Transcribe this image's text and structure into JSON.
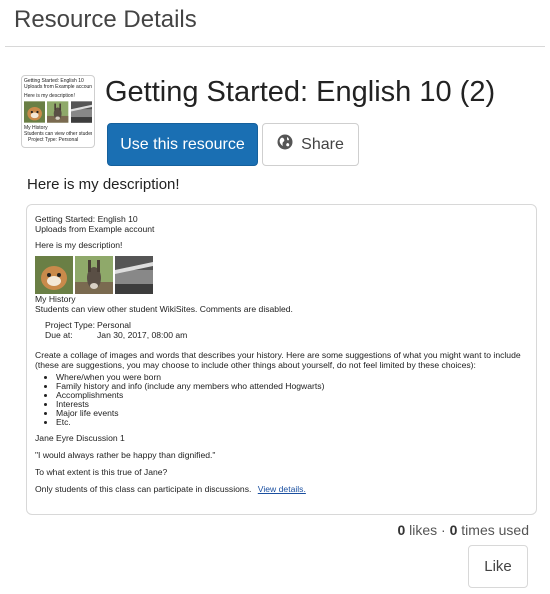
{
  "page": {
    "title": "Resource Details"
  },
  "resource": {
    "title": "Getting Started: English 10 (2)",
    "use_label": "Use this resource",
    "share_label": "Share",
    "description": "Here is my description!"
  },
  "thumbnail": {
    "line1": "Getting Started: English 10",
    "line2": "Uploads from Example account",
    "line3": "Here is my description!",
    "line4": "My History",
    "line5": "Students can view other student WikiSites...",
    "line6": "Project Type: Personal"
  },
  "preview": {
    "title": "Getting Started: English 10",
    "subtitle": "Uploads from Example account",
    "description": "Here is my description!",
    "section_title": "My History",
    "section_note": "Students can view other student WikiSites. Comments are disabled.",
    "project_type_label": "Project Type:",
    "project_type_value": "Personal",
    "due_label": "Due at:",
    "due_value": "Jan 30, 2017, 08:00 am",
    "instructions": "Create a collage of images and words that describes your history. Here are some suggestions of what you might want to include (these are suggestions, you may choose to include other things about yourself, do not feel limited by these choices):",
    "bullets": [
      "Where/when you were born",
      "Family history and info (include any members who attended Hogwarts)",
      "Accomplishments",
      "Interests",
      "Major life events",
      "Etc."
    ],
    "discussion_title": "Jane Eyre Discussion 1",
    "quote": "\"I would always rather be happy than dignified.\"",
    "question": "To what extent is this true of Jane?",
    "participation_note": "Only students of this class can participate in discussions.",
    "view_details": "View details."
  },
  "stats": {
    "likes_count": "0",
    "likes_label": "likes",
    "separator": "·",
    "used_count": "0",
    "used_label": "times used"
  },
  "like_label": "Like",
  "colors": {
    "primary": "#1a6fb3",
    "link": "#1a4fa0",
    "border": "#d8d8d8"
  }
}
